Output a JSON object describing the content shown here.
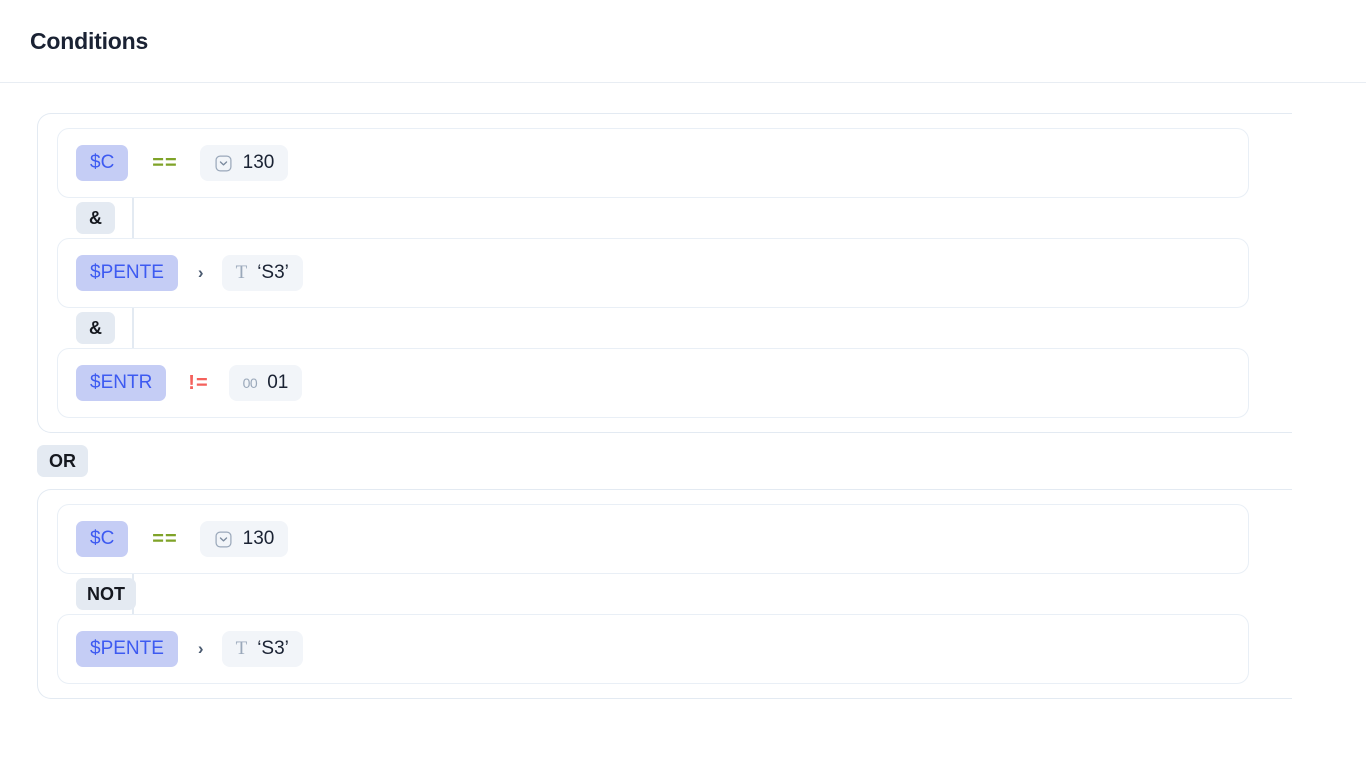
{
  "header": {
    "title": "Conditions"
  },
  "top_level_connector": "OR",
  "groups": [
    {
      "id": "group-1",
      "items": [
        {
          "kind": "condition",
          "variable": "$C",
          "operator": "==",
          "operator_kind": "equals",
          "value": "130",
          "value_type_icon": "select-chevron-icon",
          "value_type_glyph": ""
        },
        {
          "kind": "connector",
          "label": "&"
        },
        {
          "kind": "condition",
          "variable": "$PENTE",
          "operator": "›",
          "operator_kind": "greater-than",
          "value": "‘S3’",
          "value_type_icon": "text-type-icon",
          "value_type_glyph": "T"
        },
        {
          "kind": "connector",
          "label": "&"
        },
        {
          "kind": "condition",
          "variable": "$ENTR",
          "operator": "!=",
          "operator_kind": "not-equals",
          "value": "01",
          "value_type_icon": "number-type-icon",
          "value_type_glyph": "00"
        }
      ]
    },
    {
      "id": "group-2",
      "items": [
        {
          "kind": "condition",
          "variable": "$C",
          "operator": "==",
          "operator_kind": "equals",
          "value": "130",
          "value_type_icon": "select-chevron-icon",
          "value_type_glyph": ""
        },
        {
          "kind": "connector",
          "label": "NOT"
        },
        {
          "kind": "condition",
          "variable": "$PENTE",
          "operator": "›",
          "operator_kind": "greater-than",
          "value": "‘S3’",
          "value_type_icon": "text-type-icon",
          "value_type_glyph": "T"
        }
      ]
    }
  ],
  "colors": {
    "variable_chip_bg": "#c5cdf5",
    "variable_chip_text": "#3d5af1",
    "equals_operator": "#7fa328",
    "not_equals_operator": "#f4615c",
    "greater_than_operator": "#4a5a70",
    "connector_chip_bg": "#e4eaf2",
    "value_chip_bg": "#f2f5f9",
    "card_border": "#e9eff6",
    "title_text": "#1a2233"
  }
}
